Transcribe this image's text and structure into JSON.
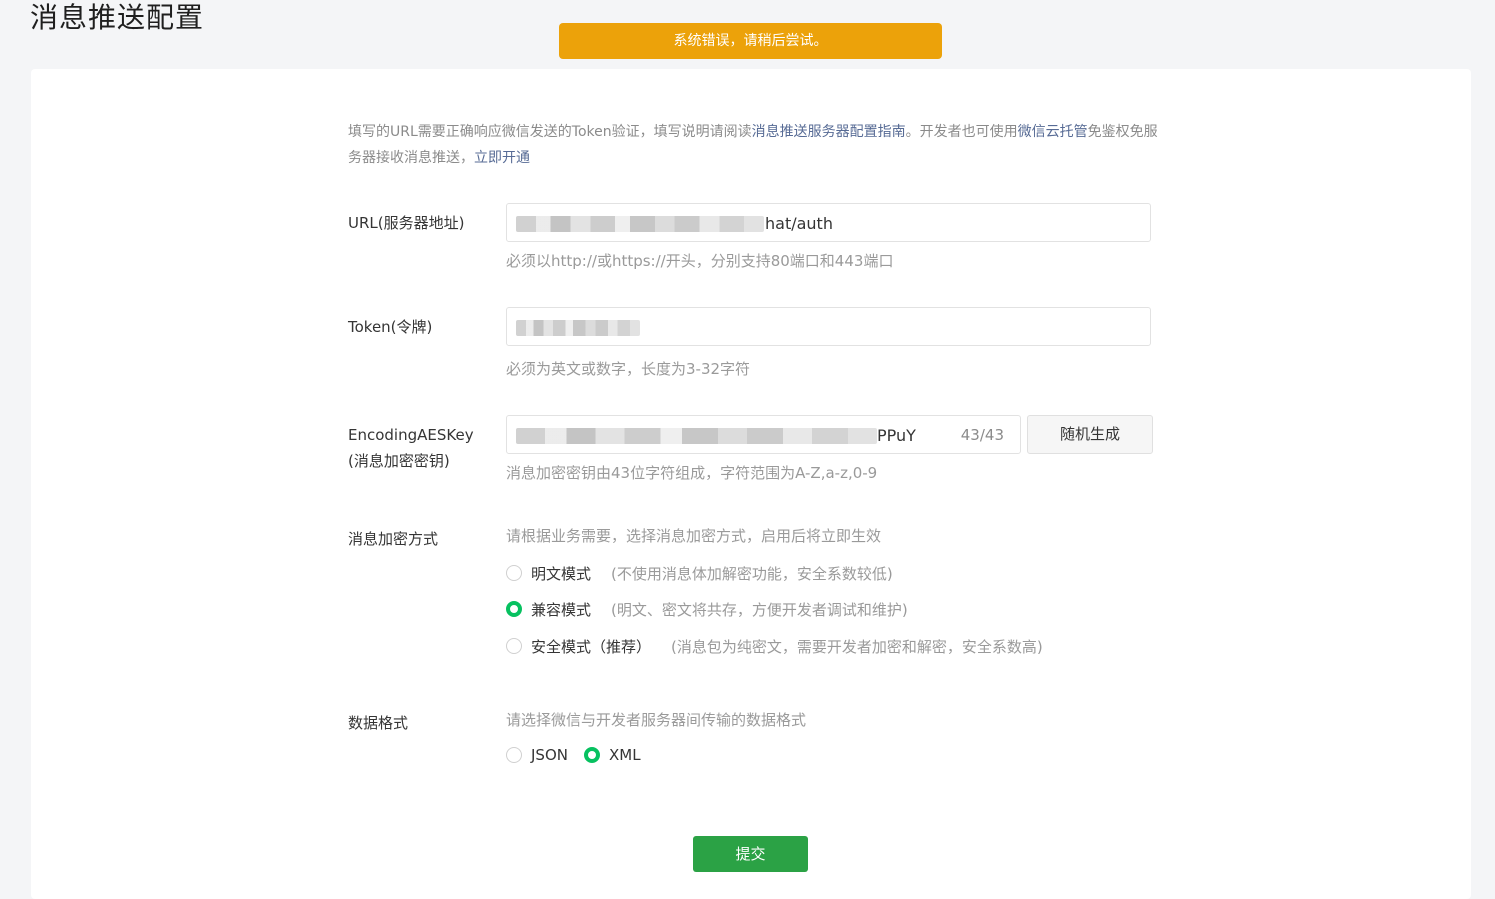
{
  "header": {
    "title": "消息推送配置"
  },
  "toast": {
    "message": "系统错误，请稍后尝试。"
  },
  "intro": {
    "text1": "填写的URL需要正确响应微信发送的Token验证，填写说明请阅读",
    "link1": "消息推送服务器配置指南",
    "text2": "。开发者也可使用",
    "link2": "微信云托管",
    "text3": "免鉴权免服务器接收消息推送，",
    "link3": "立即开通"
  },
  "url_field": {
    "label": "URL(服务器地址)",
    "value_visible": "hat/auth",
    "hint": "必须以http://或https://开头，分别支持80端口和443端口"
  },
  "token_field": {
    "label": "Token(令牌)",
    "hint": "必须为英文或数字，长度为3-32字符"
  },
  "aes_field": {
    "label_line1": "EncodingAESKey",
    "label_line2": "(消息加密密钥)",
    "value_visible": "PPuY",
    "counter": "43/43",
    "random_button": "随机生成",
    "hint": "消息加密密钥由43位字符组成，字符范围为A-Z,a-z,0-9"
  },
  "encryption": {
    "label": "消息加密方式",
    "hint": "请根据业务需要，选择消息加密方式，启用后将立即生效",
    "options": [
      {
        "label": "明文模式",
        "desc": "(不使用消息体加解密功能，安全系数较低)",
        "checked": false
      },
      {
        "label": "兼容模式",
        "desc": "(明文、密文将共存，方便开发者调试和维护)",
        "checked": true
      },
      {
        "label": "安全模式（推荐）",
        "desc": "(消息包为纯密文，需要开发者加密和解密，安全系数高)",
        "checked": false
      }
    ]
  },
  "data_format": {
    "label": "数据格式",
    "hint": "请选择微信与开发者服务器间传输的数据格式",
    "options": [
      {
        "label": "JSON",
        "checked": false
      },
      {
        "label": "XML",
        "checked": true
      }
    ]
  },
  "submit": {
    "label": "提交"
  },
  "colors": {
    "toast_bg": "#eca20a",
    "accent_green": "#07c160",
    "submit_green": "#2ba245",
    "link_blue": "#576b95"
  }
}
